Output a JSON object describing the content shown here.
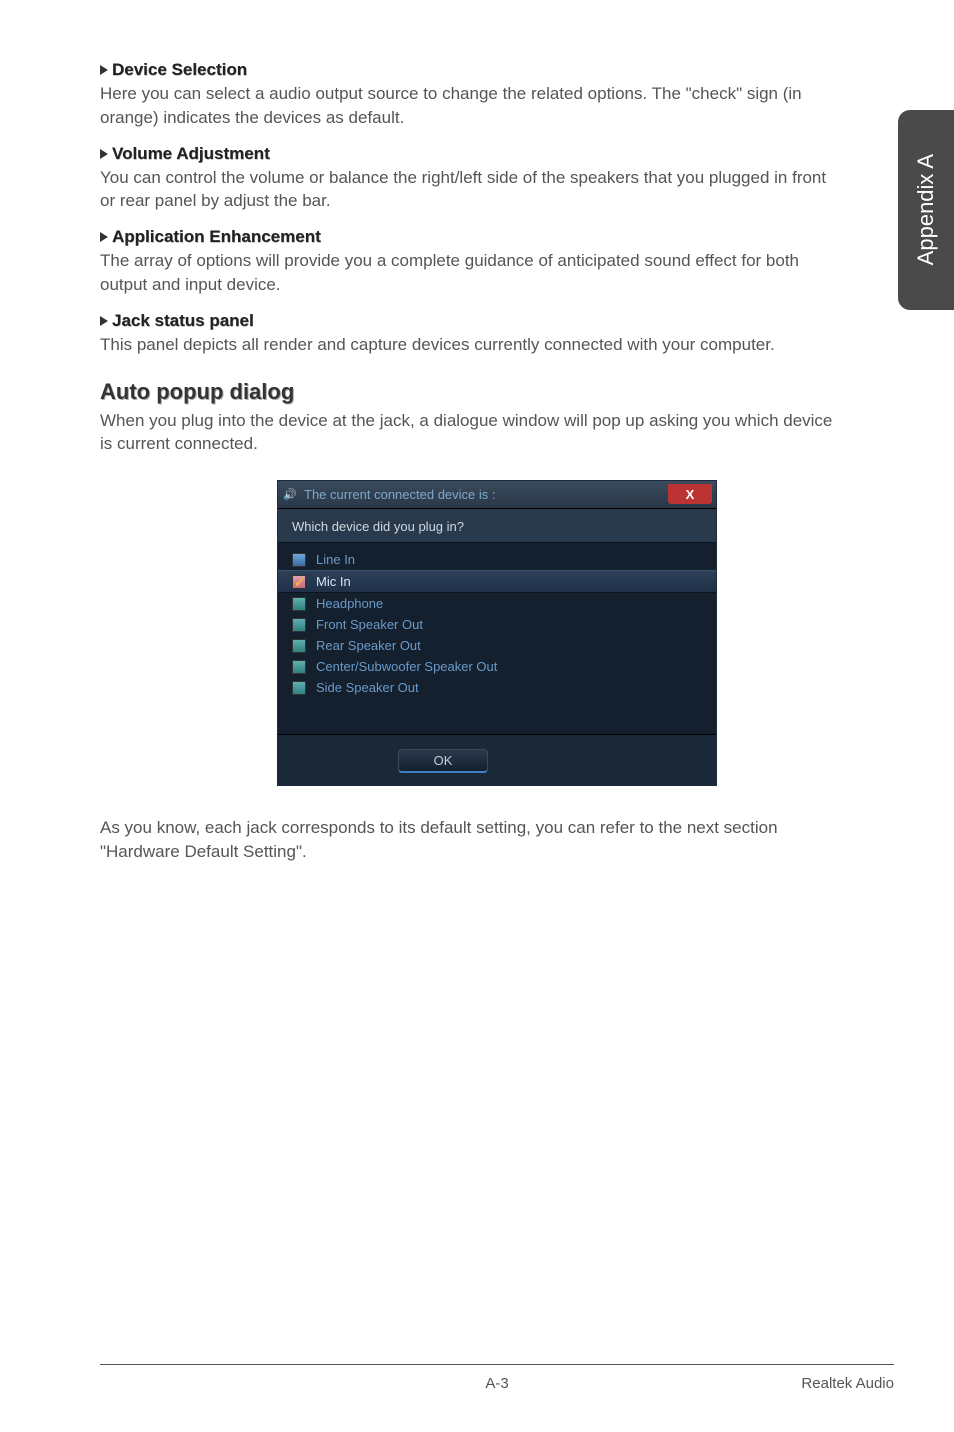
{
  "sideTab": "Appendix A",
  "sections": [
    {
      "title": "Device Selection",
      "body": "Here you can select a audio output source to change the related options. The \"check\" sign (in orange) indicates the devices as default."
    },
    {
      "title": "Volume Adjustment",
      "body": "You can control the volume or balance the right/left side of the speakers that you plugged in front or rear panel by adjust the bar."
    },
    {
      "title": "Application Enhancement",
      "body": "The array of options will provide you a complete guidance of anticipated sound effect for both output and input device."
    },
    {
      "title": "Jack status panel",
      "body": "This panel depicts all render and capture devices currently connected with your computer."
    }
  ],
  "autoPopup": {
    "heading": "Auto popup dialog",
    "body": "When you plug into the device at the jack, a dialogue window will pop up asking you which device is current connected."
  },
  "dialog": {
    "title": "The current connected device is :",
    "question": "Which device did you plug in?",
    "close": "X",
    "devices": [
      {
        "label": "Line In",
        "color": "blue",
        "checked": false,
        "selected": false
      },
      {
        "label": "Mic In",
        "color": "pink",
        "checked": true,
        "selected": true
      },
      {
        "label": "Headphone",
        "color": "teal",
        "checked": false,
        "selected": false
      },
      {
        "label": "Front Speaker Out",
        "color": "teal",
        "checked": false,
        "selected": false
      },
      {
        "label": "Rear Speaker Out",
        "color": "teal",
        "checked": false,
        "selected": false
      },
      {
        "label": "Center/Subwoofer Speaker Out",
        "color": "teal",
        "checked": false,
        "selected": false
      },
      {
        "label": "Side Speaker Out",
        "color": "teal",
        "checked": false,
        "selected": false
      }
    ],
    "ok": "OK"
  },
  "afterDialog": "As you know, each jack corresponds to its default setting, you can refer to the next section \"Hardware Default Setting\".",
  "footer": {
    "page": "A-3",
    "section": "Realtek Audio"
  }
}
